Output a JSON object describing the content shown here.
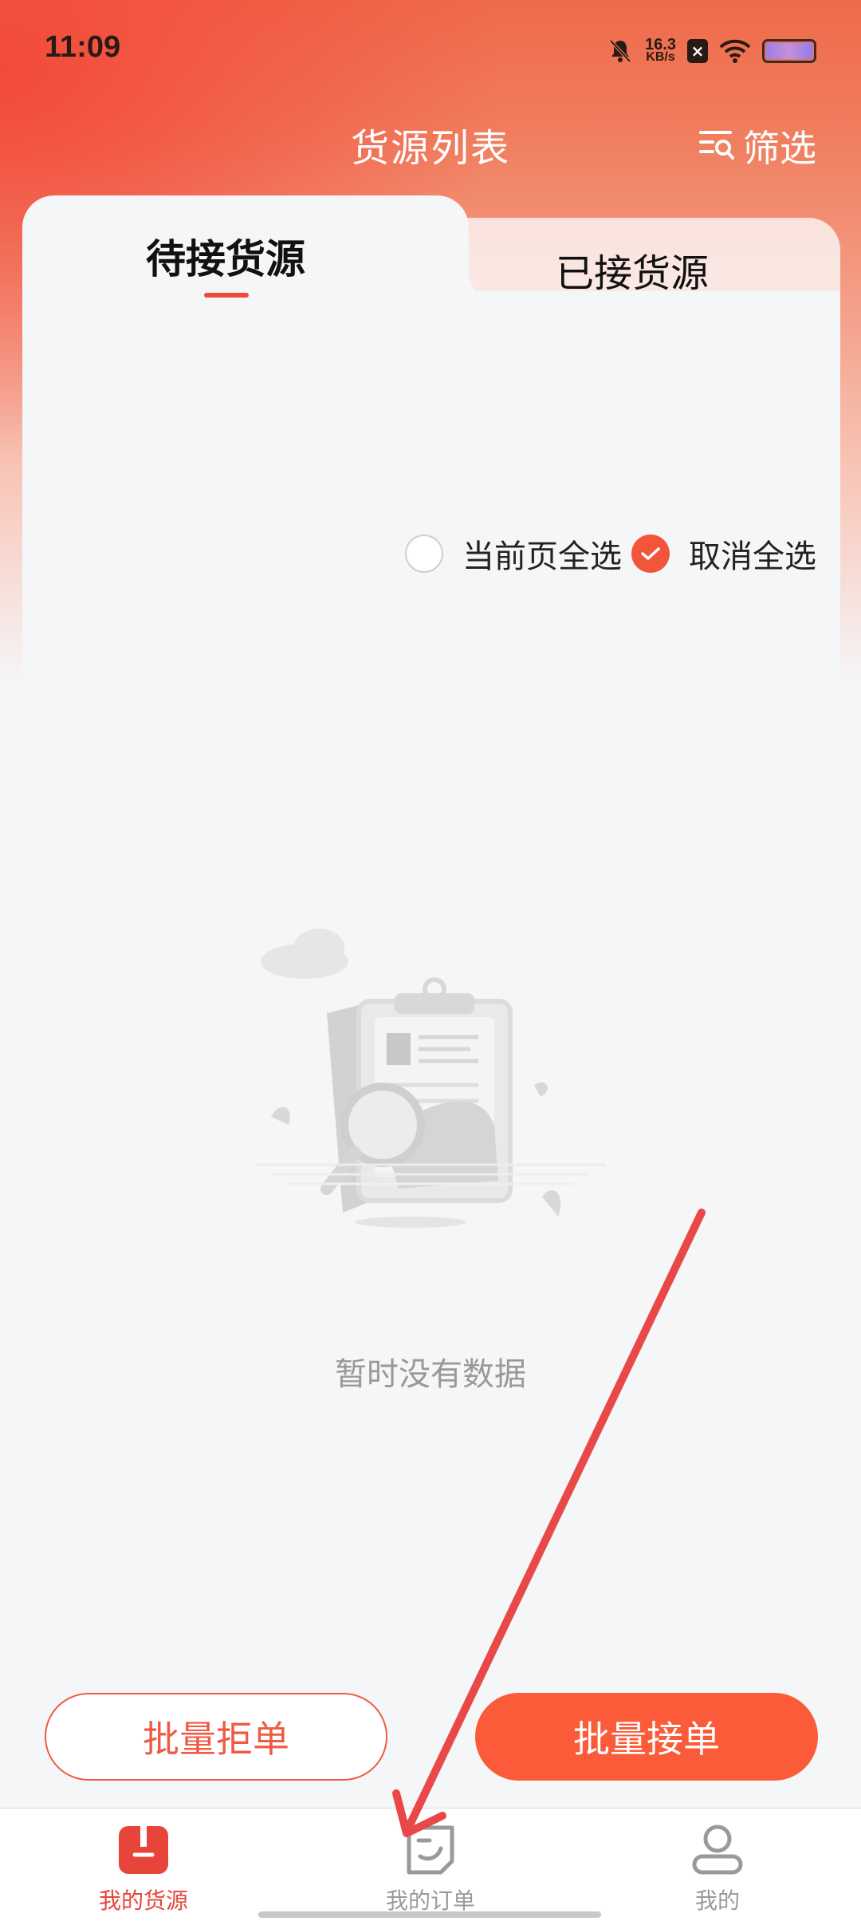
{
  "status_bar": {
    "time": "11:09",
    "net_speed_value": "16.3",
    "net_speed_unit": "KB/s",
    "icons": [
      "bell-muted-icon",
      "close-box-icon",
      "wifi-icon",
      "battery-icon"
    ]
  },
  "header": {
    "title": "货源列表",
    "filter_label": "筛选"
  },
  "tabs": [
    {
      "label": "待接货源",
      "active": true
    },
    {
      "label": "已接货源",
      "active": false
    }
  ],
  "selection": {
    "select_page_label": "当前页全选",
    "select_page_checked": false,
    "deselect_all_label": "取消全选",
    "deselect_all_checked": true
  },
  "empty_state": {
    "message": "暂时没有数据"
  },
  "actions": {
    "reject_label": "批量拒单",
    "accept_label": "批量接单"
  },
  "bottom_nav": {
    "items": [
      {
        "label": "我的货源",
        "active": true,
        "icon": "cargo-box-icon"
      },
      {
        "label": "我的订单",
        "active": false,
        "icon": "order-note-icon"
      },
      {
        "label": "我的",
        "active": false,
        "icon": "profile-icon"
      }
    ]
  },
  "colors": {
    "accent": "#fb5b38",
    "active_nav": "#e8453a",
    "inactive_nav": "#9a9a9a",
    "annotation": "#e84848"
  }
}
